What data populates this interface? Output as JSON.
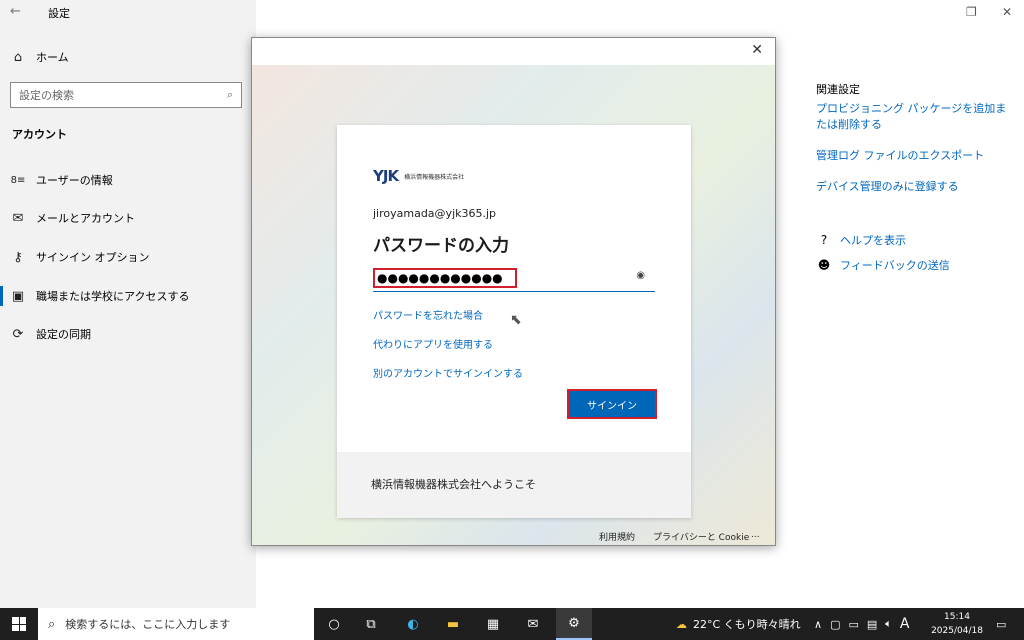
{
  "settings": {
    "app_title": "設定",
    "back_glyph": "←",
    "home_label": "ホーム",
    "search_placeholder": "設定の検索",
    "section_title": "アカウント",
    "items": [
      {
        "label": "ユーザーの情報",
        "icon": "user-info-icon"
      },
      {
        "label": "メールとアカウント",
        "icon": "mail-icon"
      },
      {
        "label": "サインイン オプション",
        "icon": "key-icon"
      },
      {
        "label": "職場または学校にアクセスする",
        "icon": "briefcase-icon"
      },
      {
        "label": "設定の同期",
        "icon": "sync-icon"
      }
    ]
  },
  "related": {
    "title": "関連設定",
    "links": [
      "プロビジョニング パッケージを追加または削除する",
      "管理ログ ファイルのエクスポート",
      "デバイス管理のみに登録する"
    ],
    "help_label": "ヘルプを表示",
    "feedback_label": "フィードバックの送信"
  },
  "dialog": {
    "company": "横浜情報機器株式会社",
    "logo_mark": "YJK",
    "email": "jiroyamada@yjk365.jp",
    "heading": "パスワードの入力",
    "password_mask": "●●●●●●●●●●●●",
    "forgot_link": "パスワードを忘れた場合",
    "app_link": "代わりにアプリを使用する",
    "other_account_link": "別のアカウントでサインインする",
    "signin_button": "サインイン",
    "welcome": "横浜情報機器株式会社へようこそ",
    "terms": "利用規約",
    "privacy": "プライバシーと Cookie",
    "more": "..."
  },
  "taskbar": {
    "search_placeholder": "検索するには、ここに入力します",
    "weather": "22°C くもり時々晴れ",
    "ime": "A",
    "time": "15:14",
    "date": "2025/04/18"
  },
  "colors": {
    "accent": "#0067c0",
    "highlight": "#d0202e",
    "button": "#0067b8"
  }
}
